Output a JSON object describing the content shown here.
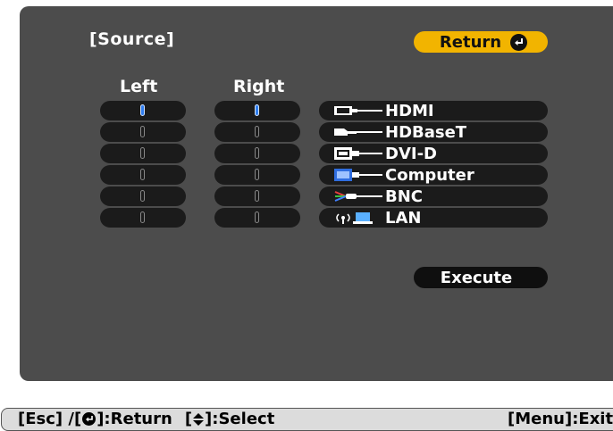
{
  "title": "[Source]",
  "return_label": "Return",
  "columns": {
    "left_label": "Left",
    "right_label": "Right"
  },
  "slots": {
    "left": [
      true,
      false,
      false,
      false,
      false,
      false
    ],
    "right": [
      true,
      false,
      false,
      false,
      false,
      false
    ]
  },
  "sources": [
    {
      "label": "HDMI",
      "icon": "hdmi-connector-icon"
    },
    {
      "label": "HDBaseT",
      "icon": "hdbaset-cable-icon"
    },
    {
      "label": "DVI-D",
      "icon": "dvi-connector-icon"
    },
    {
      "label": "Computer",
      "icon": "vga-connector-icon"
    },
    {
      "label": "BNC",
      "icon": "bnc-cable-icon"
    },
    {
      "label": "LAN",
      "icon": "lan-wireless-icon"
    }
  ],
  "execute_label": "Execute",
  "footer": {
    "esc": "[Esc] /[",
    "return": "]:Return",
    "select_open": "[",
    "select": "]:Select",
    "exit": "[Menu]:Exit"
  },
  "colors": {
    "accent": "#f2b400",
    "panel": "#4c4c4c",
    "selected": "#2f7df0"
  }
}
